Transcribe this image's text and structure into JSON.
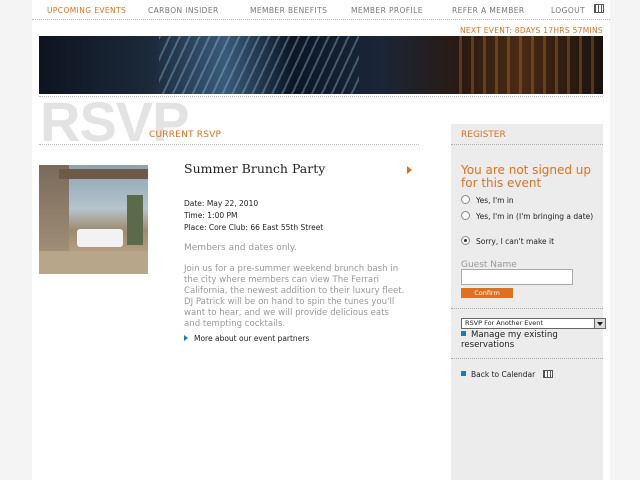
{
  "nav": {
    "items": [
      {
        "label": "UPCOMING EVENTS"
      },
      {
        "label": "CARBON INSIDER"
      },
      {
        "label": "MEMBER BENEFITS"
      },
      {
        "label": "MEMBER PROFILE"
      },
      {
        "label": "REFER A MEMBER"
      },
      {
        "label": "LOGOUT"
      }
    ],
    "calendar_icon": "calendar-icon"
  },
  "next_event": "NEXT EVENT: 8DAYS 17HRS 57MINS",
  "rsvp_heading": "RSVP",
  "current_rsvp": "CURRENT RSVP",
  "event": {
    "title": "Summer Brunch Party",
    "date": "Date: May 22, 2010",
    "time": "Time: 1:00 PM",
    "place": "Place: Core Club: 66 East 55th Street",
    "members_only": "Members and dates only.",
    "description": "Join us for a pre-summer weekend brunch bash in the city where members can view The Ferrari California, the newest addition to their luxury fleet. DJ Patrick will be on hand to spin the tunes you'll want to hear, and we will provide delicious eats and tempting cocktails.",
    "partners_link": "More about our event partners"
  },
  "register": {
    "heading": "REGISTER",
    "status": "You are not signed up for this event",
    "options": [
      {
        "label": "Yes, I'm in",
        "checked": false
      },
      {
        "label": "Yes, I'm in (I'm bringing a date)",
        "checked": false
      },
      {
        "label": "Sorry, I can't make it",
        "checked": true
      }
    ],
    "guest_label": "Guest Name",
    "guest_value": "",
    "confirm_label": "Confirm",
    "select_value": "RSVP For Another Event",
    "manage_link": "Manage my existing reservations",
    "back_link": "Back to Calendar"
  },
  "colors": {
    "accent": "#e07020",
    "link_bullet": "#1a7bb5"
  }
}
